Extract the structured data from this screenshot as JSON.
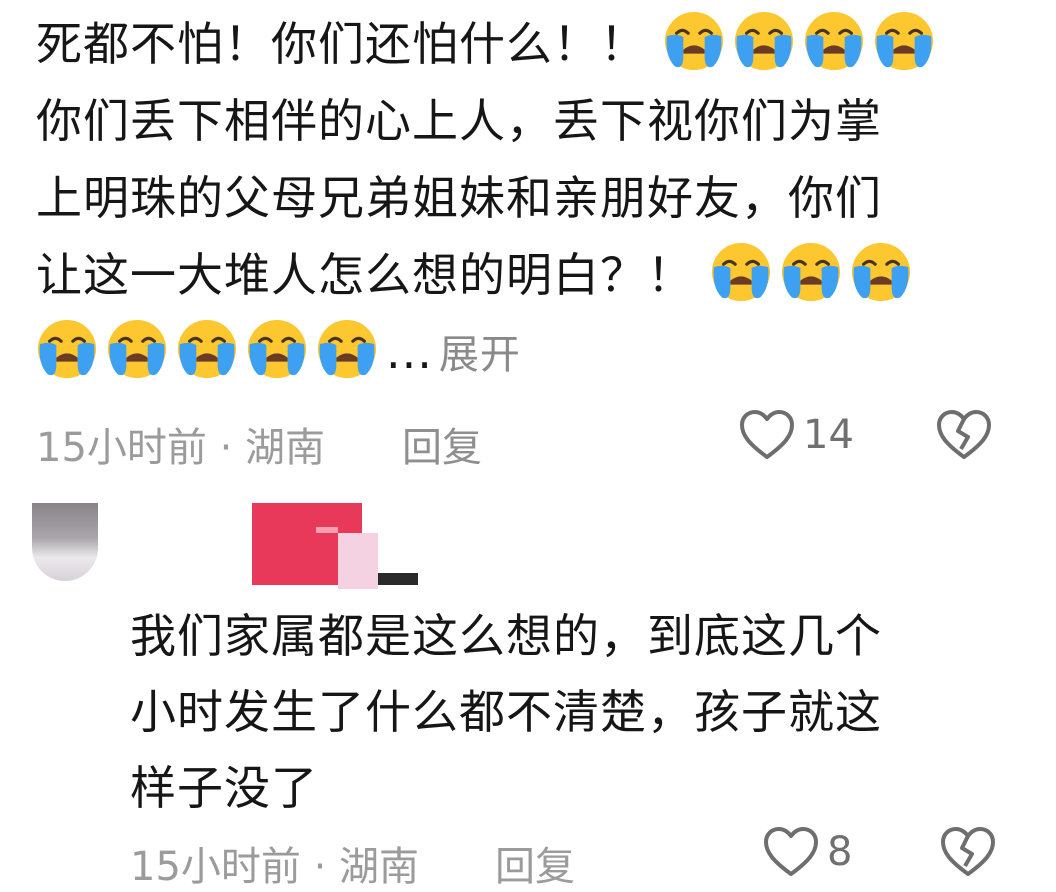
{
  "comment": {
    "line1": "死都不怕！你们还怕什么！！",
    "line2": "你们丢下相伴的心上人，丢下视你们为掌",
    "line3": "上明珠的父母兄弟姐妹和亲朋好友，你们",
    "line4": "让这一大堆人怎么想的明白？！",
    "ellipsis": "...",
    "expand_label": "展开",
    "emoji_icon": "loudly-crying-face",
    "time_location": "15小时前 · 湖南",
    "reply_label": "回复",
    "like_count": "14"
  },
  "reply_comment": {
    "line1": "我们家属都是这么想的，到底这几个",
    "line2": "小时发生了什么都不清楚，孩子就这",
    "line3": "样子没了",
    "time_location": "15小时前 · 湖南",
    "reply_label": "回复",
    "like_count": "8"
  },
  "colors": {
    "text": "#161616",
    "meta": "#9b9b9b",
    "emoji_face": "#fcc72f",
    "emoji_tears": "#3ea0f0"
  }
}
